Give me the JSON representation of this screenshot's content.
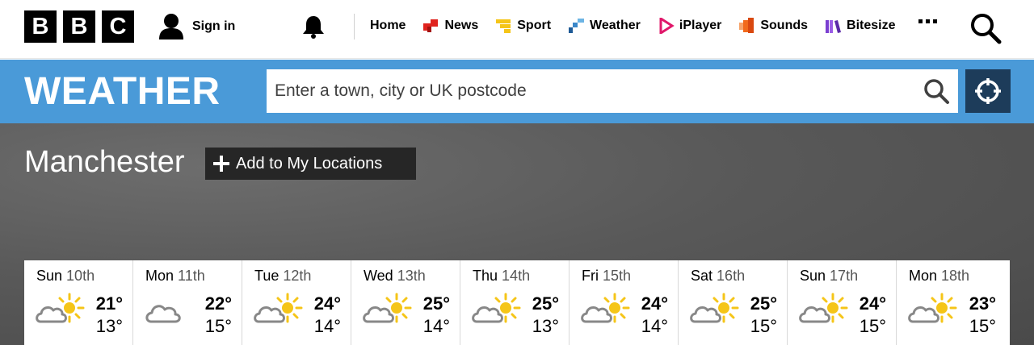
{
  "brand": {
    "letters": [
      "B",
      "B",
      "C"
    ]
  },
  "nav": {
    "sign_in": "Sign in",
    "items": [
      {
        "label": "Home",
        "icon": "none"
      },
      {
        "label": "News",
        "icon": "news-icon",
        "color": "#e0231e"
      },
      {
        "label": "Sport",
        "icon": "sport-icon",
        "color": "#f5c518"
      },
      {
        "label": "Weather",
        "icon": "weather-icon",
        "color": "#3a87c9"
      },
      {
        "label": "iPlayer",
        "icon": "iplayer-icon",
        "color": "#e0186a"
      },
      {
        "label": "Sounds",
        "icon": "sounds-icon",
        "color": "#f26a1b"
      },
      {
        "label": "Bitesize",
        "icon": "bitesize-icon",
        "color": "#7b3fd1"
      }
    ]
  },
  "weather_bar": {
    "title": "WEATHER",
    "search_placeholder": "Enter a town, city or UK postcode",
    "colors": {
      "bar": "#4a9ad8",
      "locate": "#1d3c5a"
    }
  },
  "location": {
    "name": "Manchester",
    "add_label": "Add to My Locations"
  },
  "forecast": [
    {
      "day": "Sun",
      "date": "10th",
      "high": "21°",
      "low": "13°",
      "icon": "sun-cloud-icon"
    },
    {
      "day": "Mon",
      "date": "11th",
      "high": "22°",
      "low": "15°",
      "icon": "cloud-icon"
    },
    {
      "day": "Tue",
      "date": "12th",
      "high": "24°",
      "low": "14°",
      "icon": "sun-cloud-icon"
    },
    {
      "day": "Wed",
      "date": "13th",
      "high": "25°",
      "low": "14°",
      "icon": "sun-cloud-icon"
    },
    {
      "day": "Thu",
      "date": "14th",
      "high": "25°",
      "low": "13°",
      "icon": "sun-cloud-icon"
    },
    {
      "day": "Fri",
      "date": "15th",
      "high": "24°",
      "low": "14°",
      "icon": "sun-cloud-icon"
    },
    {
      "day": "Sat",
      "date": "16th",
      "high": "25°",
      "low": "15°",
      "icon": "sun-cloud-icon"
    },
    {
      "day": "Sun",
      "date": "17th",
      "high": "24°",
      "low": "15°",
      "icon": "sun-cloud-icon"
    },
    {
      "day": "Mon",
      "date": "18th",
      "high": "23°",
      "low": "15°",
      "icon": "sun-cloud-icon"
    }
  ]
}
